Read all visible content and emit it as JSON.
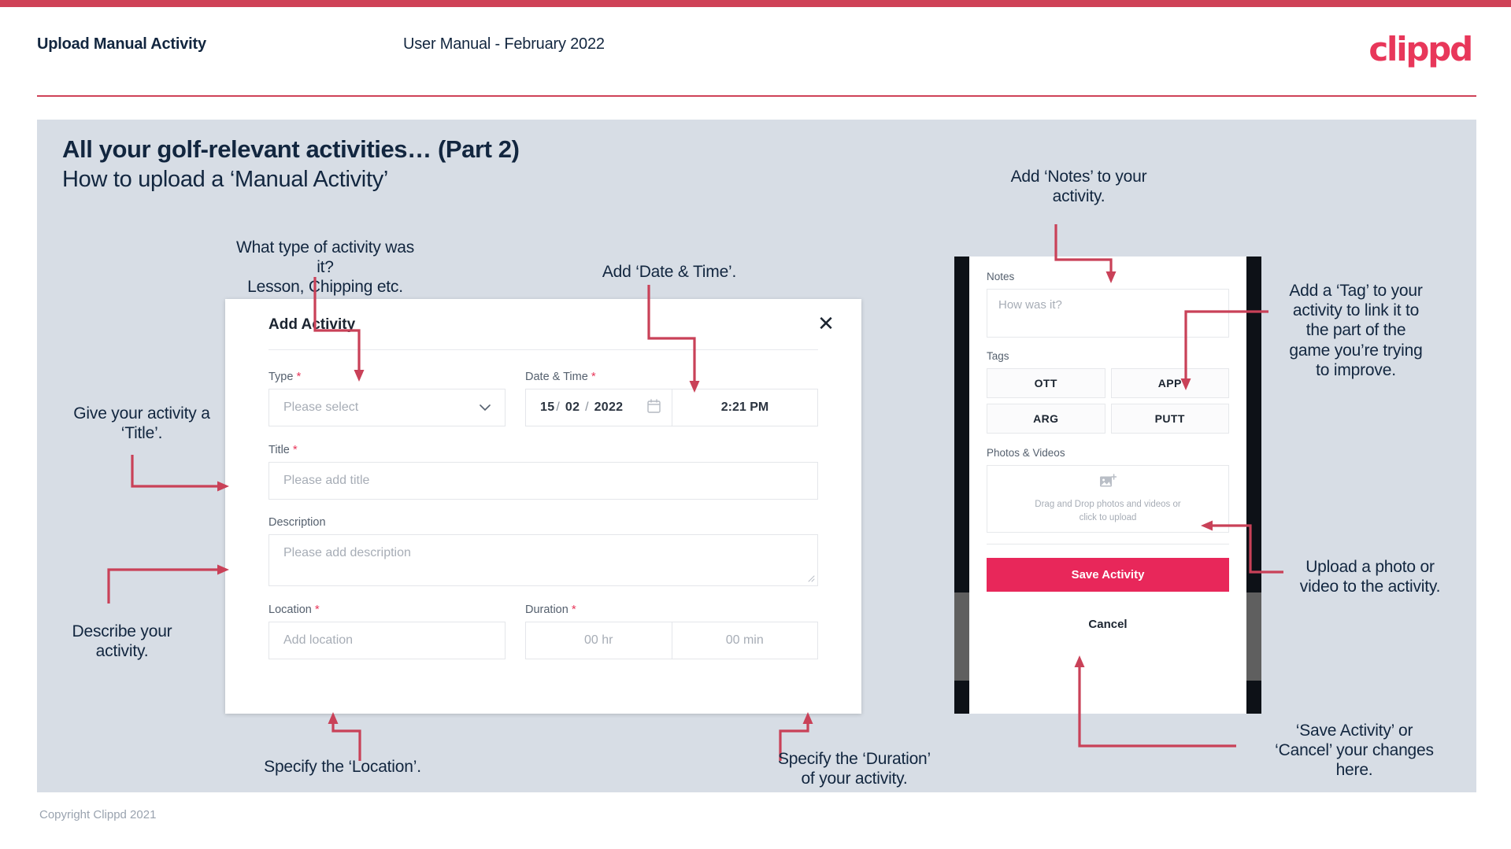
{
  "header": {
    "title": "Upload Manual Activity",
    "subtitle": "User Manual - February 2022",
    "logo": "clippd"
  },
  "slide": {
    "title": "All your golf-relevant activities… (Part 2)",
    "subtitle": "How to upload a ‘Manual Activity’"
  },
  "footer": {
    "copyright": "Copyright Clippd 2021"
  },
  "dialog": {
    "title": "Add Activity",
    "close_icon": "✕",
    "fields": {
      "type": {
        "label": "Type",
        "required": "*",
        "placeholder": "Please select",
        "chevron": "⌄"
      },
      "datetime": {
        "label": "Date & Time",
        "required": "*",
        "day": "15",
        "month": "02",
        "year": "2022",
        "separator": "/",
        "time": "2:21 PM"
      },
      "title": {
        "label": "Title",
        "required": "*",
        "placeholder": "Please add title"
      },
      "description": {
        "label": "Description",
        "placeholder": "Please add description"
      },
      "location": {
        "label": "Location",
        "required": "*",
        "placeholder": "Add location"
      },
      "duration": {
        "label": "Duration",
        "required": "*",
        "hours_placeholder": "00 hr",
        "minutes_placeholder": "00 min"
      }
    }
  },
  "phone": {
    "notes": {
      "label": "Notes",
      "placeholder": "How was it?"
    },
    "tags": {
      "label": "Tags",
      "items": [
        "OTT",
        "APP",
        "ARG",
        "PUTT"
      ]
    },
    "photos": {
      "label": "Photos & Videos",
      "drop_line1": "Drag and Drop photos and videos or",
      "drop_line2": "click to upload"
    },
    "save_label": "Save Activity",
    "cancel_label": "Cancel"
  },
  "annotations": {
    "type": "What type of activity was it?\nLesson, Chipping etc.",
    "type_l1": "What type of activity was it?",
    "type_l2": "Lesson, Chipping etc.",
    "datetime": "Add ‘Date & Time’.",
    "notes_l1": "Add ‘Notes’ to your",
    "notes_l2": "activity.",
    "tag_l1": "Add a ‘Tag’ to your",
    "tag_l2": "activity to link it to",
    "tag_l3": "the part of the",
    "tag_l4": "game you’re trying",
    "tag_l5": "to improve.",
    "title_l1": "Give your activity a",
    "title_l2": "‘Title’.",
    "describe_l1": "Describe your",
    "describe_l2": "activity.",
    "location": "Specify the ‘Location’.",
    "duration_l1": "Specify the ‘Duration’",
    "duration_l2": "of your activity.",
    "upload_l1": "Upload a photo or",
    "upload_l2": "video to the activity.",
    "save_l1": "‘Save Activity’ or",
    "save_l2": "‘Cancel’ your changes",
    "save_l3": "here."
  },
  "colors": {
    "brand": "#e8375a",
    "accent_bar": "#cf4257",
    "arrow": "#c94158",
    "slide_bg": "#d7dde5",
    "text": "#12263f"
  }
}
